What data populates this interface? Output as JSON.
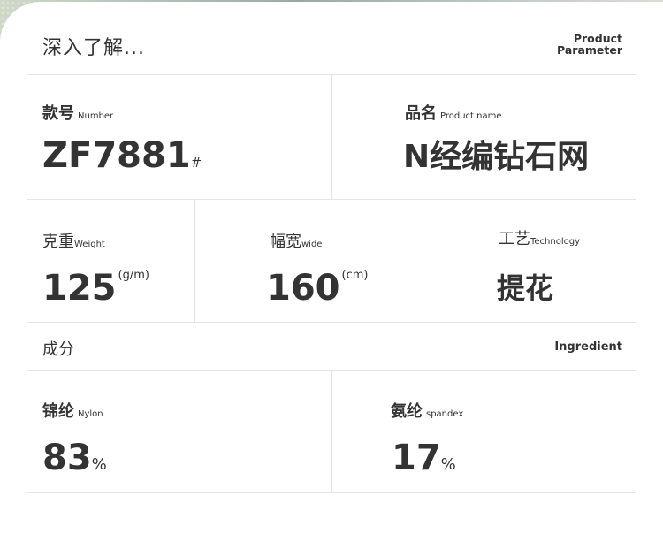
{
  "header": {
    "title": "深入了解...",
    "en_line1": "Product",
    "en_line2": "Parameter"
  },
  "number": {
    "label_cn": "款号",
    "label_en": "Number",
    "value": "ZF7881",
    "unit": "#"
  },
  "product_name": {
    "label_cn": "品名",
    "label_en": "Product name",
    "value": "N经编钻石网"
  },
  "weight": {
    "label_cn": "克重",
    "label_en": "Weight",
    "value": "125",
    "unit": "(g/m)"
  },
  "width": {
    "label_cn": "幅宽",
    "label_en": "wide",
    "value": "160",
    "unit": "(cm)"
  },
  "technology": {
    "label_cn": "工艺",
    "label_en": "Technology",
    "value": "提花"
  },
  "ingredient": {
    "label_cn": "成分",
    "label_en": "Ingredient"
  },
  "nylon": {
    "label_cn": "锦纶",
    "label_en": "Nylon",
    "value": "83",
    "unit": "%"
  },
  "spandex": {
    "label_cn": "氨纶",
    "label_en": "spandex",
    "value": "17",
    "unit": "%"
  }
}
